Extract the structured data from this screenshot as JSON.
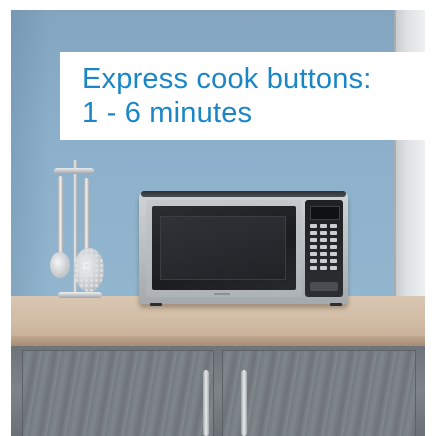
{
  "caption": {
    "line1": "Express cook buttons:",
    "line2": "1 - 6 minutes",
    "color": "#1a86c7"
  },
  "scene": {
    "subject": "microwave-oven",
    "wall_color": "#8cb0cb",
    "counter_color": "#d2bda6",
    "cabinet_color": "#767c81"
  }
}
